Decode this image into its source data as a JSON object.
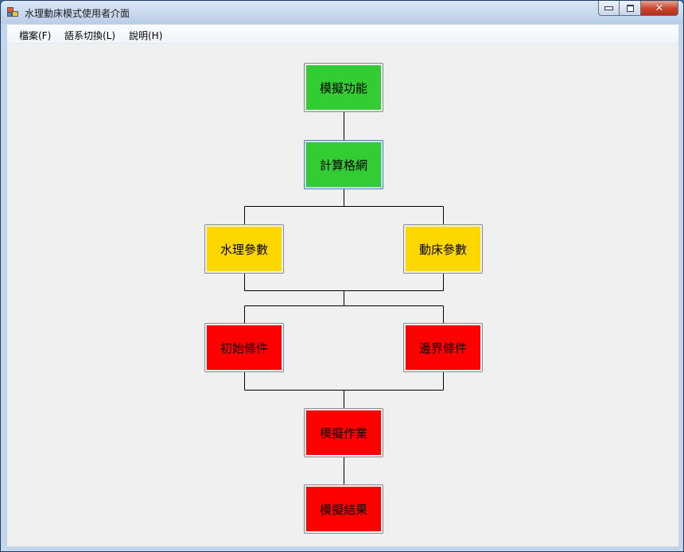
{
  "window": {
    "title": "水理動床模式使用者介面"
  },
  "menu": [
    {
      "label": "檔案(F)"
    },
    {
      "label": "語系切換(L)"
    },
    {
      "label": "說明(H)"
    }
  ],
  "colors": {
    "green": "#33cc33",
    "yellow": "#ffd700",
    "red": "#ff0000"
  },
  "flow": {
    "simulate_function": {
      "label": "模擬功能",
      "color": "#33cc33"
    },
    "computational_grid": {
      "label": "計算格網",
      "color": "#33cc33"
    },
    "hydraulic_params": {
      "label": "水理參數",
      "color": "#ffd700"
    },
    "mobile_bed_params": {
      "label": "動床參數",
      "color": "#ffd700"
    },
    "initial_conditions": {
      "label": "初始條件",
      "color": "#ff0000"
    },
    "boundary_conditions": {
      "label": "邊界條件",
      "color": "#ff0000"
    },
    "simulation_run": {
      "label": "模擬作業",
      "color": "#ff0000"
    },
    "simulation_results": {
      "label": "模擬結果",
      "color": "#ff0000"
    }
  }
}
